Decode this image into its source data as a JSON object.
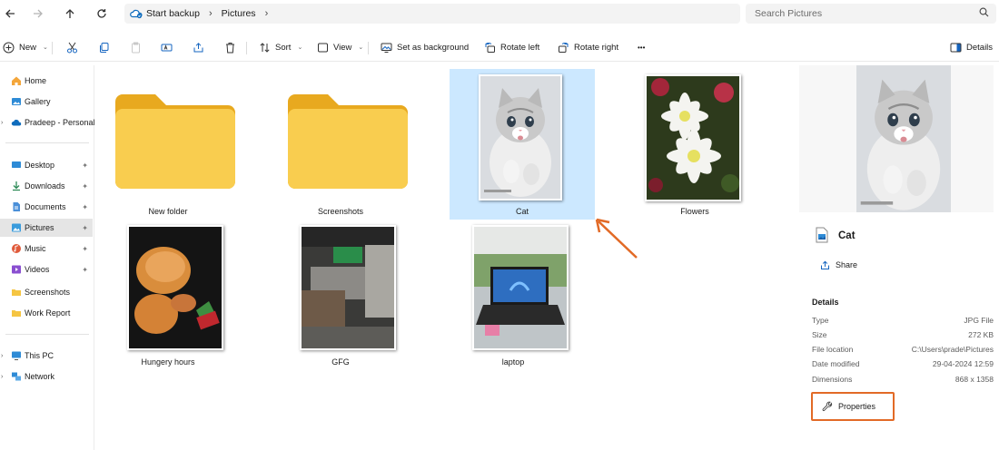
{
  "address": {
    "back_icon": "arrow-left-icon",
    "forward_icon": "arrow-right-icon",
    "up_icon": "arrow-up-icon",
    "refresh_icon": "refresh-icon",
    "breadcrumbs": [
      "Start backup",
      "Pictures"
    ],
    "search_placeholder": "Search Pictures"
  },
  "commands": {
    "new": "New",
    "sort": "Sort",
    "view": "View",
    "set_background": "Set as background",
    "rotate_left": "Rotate left",
    "rotate_right": "Rotate right",
    "more": "•••",
    "details": "Details"
  },
  "sidebar": {
    "items": [
      {
        "label": "Home",
        "icon": "home-icon"
      },
      {
        "label": "Gallery",
        "icon": "gallery-icon"
      },
      {
        "label": "Pradeep - Personal",
        "icon": "onedrive-cloud-icon"
      },
      {
        "label": "Desktop",
        "icon": "desktop-icon"
      },
      {
        "label": "Downloads",
        "icon": "download-icon"
      },
      {
        "label": "Documents",
        "icon": "documents-icon"
      },
      {
        "label": "Pictures",
        "icon": "pictures-icon",
        "selected": true
      },
      {
        "label": "Music",
        "icon": "music-icon"
      },
      {
        "label": "Videos",
        "icon": "videos-icon"
      },
      {
        "label": "Screenshots",
        "icon": "folder-icon"
      },
      {
        "label": "Work Report",
        "icon": "folder-icon"
      },
      {
        "label": "This PC",
        "icon": "this-pc-icon"
      },
      {
        "label": "Network",
        "icon": "network-icon"
      }
    ]
  },
  "files": [
    {
      "name": "New folder",
      "kind": "folder"
    },
    {
      "name": "Screenshots",
      "kind": "folder"
    },
    {
      "name": "Cat",
      "kind": "image",
      "selected": true
    },
    {
      "name": "Flowers",
      "kind": "image"
    },
    {
      "name": "Hungery hours",
      "kind": "image"
    },
    {
      "name": "GFG",
      "kind": "image"
    },
    {
      "name": "laptop",
      "kind": "image"
    }
  ],
  "details_pane": {
    "title": "Cat",
    "share": "Share",
    "heading": "Details",
    "rows": [
      {
        "label": "Type",
        "value": "JPG File"
      },
      {
        "label": "Size",
        "value": "272 KB"
      },
      {
        "label": "File location",
        "value": "C:\\Users\\prade\\Pictures"
      },
      {
        "label": "Date modified",
        "value": "29-04-2024 12:59"
      },
      {
        "label": "Dimensions",
        "value": "868 x 1358"
      }
    ],
    "properties": "Properties"
  },
  "colors": {
    "selection": "#cce8ff",
    "annotation": "#e26a26",
    "folder_yellow": "#f7c943"
  }
}
